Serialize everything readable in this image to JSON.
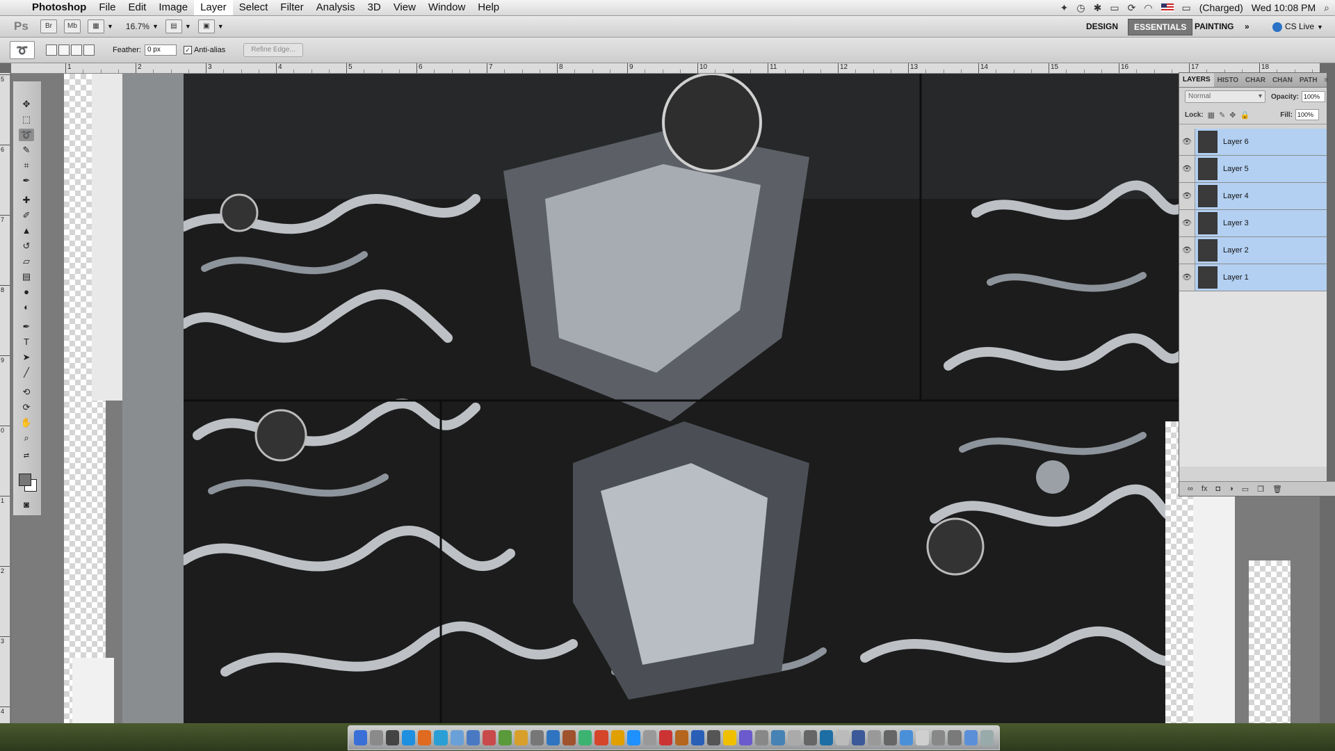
{
  "menubar": {
    "app_name": "Photoshop",
    "items": [
      "File",
      "Edit",
      "Image",
      "Layer",
      "Select",
      "Filter",
      "Analysis",
      "3D",
      "View",
      "Window",
      "Help"
    ],
    "active_item": "Layer",
    "battery": "(Charged)",
    "clock": "Wed 10:08 PM"
  },
  "appbar": {
    "logo": "Ps",
    "bridge": "Br",
    "minibridge": "Mb",
    "zoom": "16.7%",
    "workspaces": {
      "design": "DESIGN",
      "essentials": "ESSENTIALS",
      "painting": "PAINTING",
      "more": "»"
    },
    "cs_live": "CS Live"
  },
  "options": {
    "feather_label": "Feather:",
    "feather_value": "0 px",
    "antialias_label": "Anti-alias",
    "antialias_checked": true,
    "refine_edge": "Refine Edge..."
  },
  "ruler_top": [
    "1",
    "2",
    "3",
    "4",
    "5",
    "6",
    "7",
    "8",
    "9",
    "10",
    "11",
    "12",
    "13",
    "14",
    "15",
    "16",
    "17",
    "18"
  ],
  "ruler_left": [
    "5",
    "6",
    "7",
    "8",
    "9",
    "0",
    "1",
    "2",
    "3",
    "4"
  ],
  "layers_panel": {
    "tabs": [
      "LAYERS",
      "HISTO",
      "CHAR",
      "CHAN",
      "PATH"
    ],
    "blend_mode": "Normal",
    "opacity_label": "Opacity:",
    "opacity": "100%",
    "lock_label": "Lock:",
    "fill_label": "Fill:",
    "fill": "100%",
    "layers": [
      {
        "name": "Layer 6",
        "visible": true,
        "selected": true
      },
      {
        "name": "Layer 5",
        "visible": true,
        "selected": true
      },
      {
        "name": "Layer 4",
        "visible": true,
        "selected": true
      },
      {
        "name": "Layer 3",
        "visible": true,
        "selected": true
      },
      {
        "name": "Layer 2",
        "visible": true,
        "selected": true
      },
      {
        "name": "Layer 1",
        "visible": true,
        "selected": true
      }
    ]
  },
  "colors": {
    "selection": "#b3d0f2",
    "workspace_active": "#777777",
    "foreground": "#767676",
    "background": "#ffffff"
  }
}
